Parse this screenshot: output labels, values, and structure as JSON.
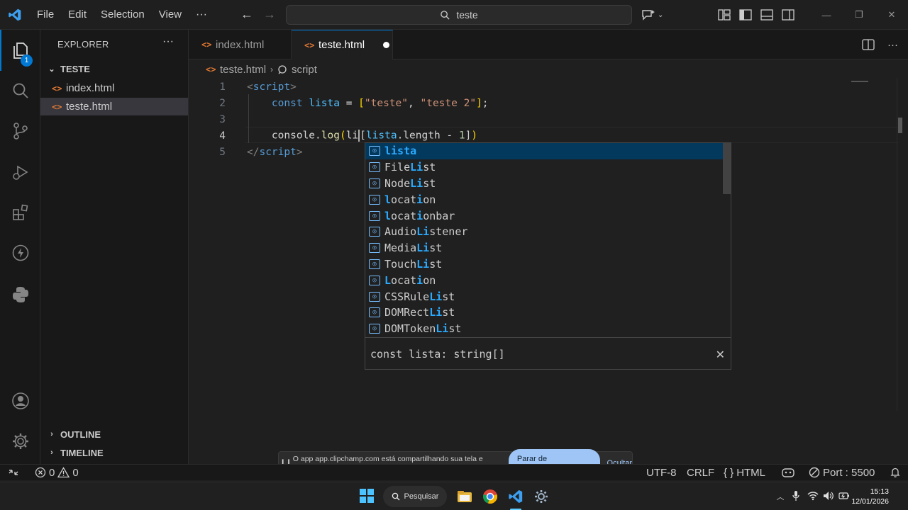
{
  "menu": {
    "file": "File",
    "edit": "Edit",
    "selection": "Selection",
    "view": "View",
    "more": "···"
  },
  "command_center": {
    "text": "teste"
  },
  "activity": {
    "explorer_badge": "1"
  },
  "sidebar": {
    "title": "EXPLORER",
    "folder": "TESTE",
    "files": [
      "index.html",
      "teste.html"
    ],
    "outline": "OUTLINE",
    "timeline": "TIMELINE"
  },
  "tabs": [
    {
      "label": "index.html"
    },
    {
      "label": "teste.html"
    }
  ],
  "breadcrumb": {
    "file": "teste.html",
    "symbol": "script"
  },
  "editor": {
    "line_numbers": [
      "1",
      "2",
      "3",
      "4",
      "5"
    ]
  },
  "suggest": {
    "items": [
      {
        "pre": "",
        "hl": "lista",
        "post": ""
      },
      {
        "pre": "File",
        "hl": "Li",
        "post": "st"
      },
      {
        "pre": "Node",
        "hl": "Li",
        "post": "st"
      },
      {
        "pre": "",
        "hl": "l",
        "post": "ocat",
        "hl2": "i",
        "post2": "on"
      },
      {
        "pre": "",
        "hl": "l",
        "post": "ocat",
        "hl2": "i",
        "post2": "onbar"
      },
      {
        "pre": "Audio",
        "hl": "Li",
        "post": "stener"
      },
      {
        "pre": "Media",
        "hl": "Li",
        "post": "st"
      },
      {
        "pre": "Touch",
        "hl": "Li",
        "post": "st"
      },
      {
        "pre": "",
        "hl": "L",
        "post": "ocat",
        "hl2": "i",
        "post2": "on"
      },
      {
        "pre": "CSSRule",
        "hl": "Li",
        "post": "st"
      },
      {
        "pre": "DOMRect",
        "hl": "Li",
        "post": "st"
      },
      {
        "pre": "DOMToken",
        "hl": "Li",
        "post": "st"
      }
    ],
    "detail": "const lista: string[]",
    "close": "✕"
  },
  "share": {
    "message": "O app app.clipchamp.com está compartilhando sua tela e áudio.",
    "stop": "Parar de compartilhar",
    "hide": "Ocultar"
  },
  "status": {
    "errors": "0",
    "warnings": "0",
    "encoding": "UTF-8",
    "eol": "CRLF",
    "language": "HTML",
    "port": "Port : 5500"
  },
  "taskbar": {
    "search": "Pesquisar",
    "time": "15:13",
    "date": "12/01/2026"
  },
  "colors": {
    "accent": "#0078d4",
    "background": "#1f1f1f",
    "sidebar": "#181818"
  }
}
